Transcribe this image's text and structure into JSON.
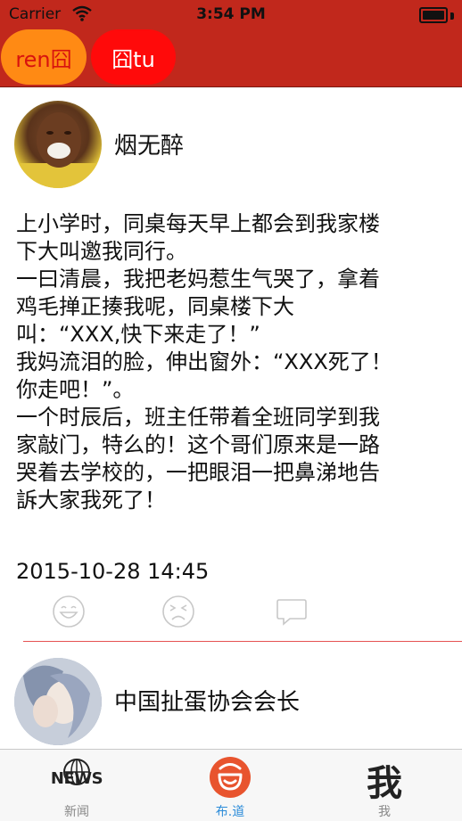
{
  "status_bar": {
    "carrier": "Carrier",
    "time": "3:54 PM"
  },
  "header": {
    "tabs": [
      {
        "label": "ren囧",
        "color": "#ff8a14",
        "text_color": "#d8120e"
      },
      {
        "label": "囧tu",
        "color": "#ff0a0a",
        "text_color": "#ffffff"
      }
    ],
    "background_color": "#c1281c"
  },
  "posts": [
    {
      "username": "烟无醉",
      "text": "上小学时，同桌每天早上都会到我家楼\n下大叫邀我同行。\n一曰清晨，我把老妈惹生气哭了，拿着\n鸡毛掸正揍我呢，同桌楼下大\n叫：“XXX,快下来走了！”\n我妈流泪的脸，伸出窗外：“XXX死了！\n你走吧！”。\n一个时辰后，班主任带着全班同学到我\n家敲门，特么的！这个哥们原来是一路\n哭着去学校的，一把眼泪一把鼻涕地告\n訴大家我死了！",
      "time": "2015-10-28 14:45",
      "actions": [
        "smile-icon",
        "frown-icon",
        "comment-icon"
      ]
    },
    {
      "username": "中国扯蛋协会会长"
    }
  ],
  "tabbar": {
    "items": [
      {
        "label": "新闻",
        "icon": "news-globe-icon",
        "icon_text": "NEWS"
      },
      {
        "label": "布.道",
        "icon": "smile-face-icon",
        "active": true,
        "active_color": "#2c8cd9"
      },
      {
        "label": "我",
        "icon": "me-glyph-icon",
        "icon_text": "我"
      }
    ]
  }
}
